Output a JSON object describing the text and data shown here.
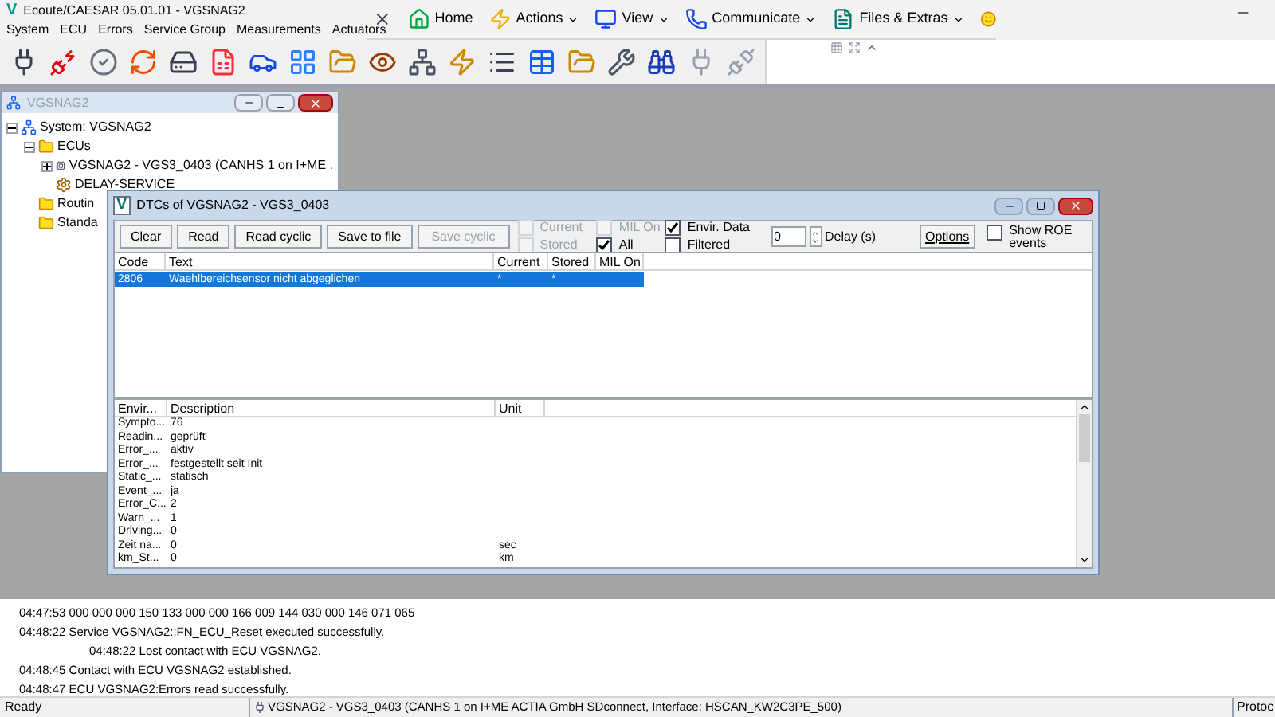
{
  "window": {
    "title": "Ecoute/CAESAR 05.01.01 - VGSNAG2",
    "logo": "V"
  },
  "menu": [
    "System",
    "ECU",
    "Errors",
    "Service Group",
    "Measurements",
    "Actuators"
  ],
  "ribbon": [
    {
      "label": "Home",
      "kind": "home"
    },
    {
      "label": "Actions",
      "kind": "actions"
    },
    {
      "label": "View",
      "kind": "view"
    },
    {
      "label": "Communicate",
      "kind": "communicate"
    },
    {
      "label": "Files & Extras",
      "kind": "files"
    }
  ],
  "tree_window": {
    "title": "VGSNAG2",
    "tree": [
      {
        "label": "System: VGSNAG2",
        "expanded": true,
        "children": [
          {
            "label": "ECUs",
            "expanded": true,
            "children": [
              {
                "label": "VGSNAG2 - VGS3_0403 (CANHS 1 on I+ME .",
                "expanded": false,
                "kind": "ecu"
              },
              {
                "label": "DELAY-SERVICE",
                "kind": "service"
              }
            ]
          },
          {
            "label": "Routin"
          },
          {
            "label": "Standa"
          }
        ]
      }
    ]
  },
  "dtc_window": {
    "title": "DTCs of VGSNAG2 - VGS3_0403",
    "logo": "V",
    "buttons": [
      {
        "label": "Clear",
        "disabled": false
      },
      {
        "label": "Read",
        "disabled": false
      },
      {
        "label": "Read cyclic",
        "disabled": false
      },
      {
        "label": "Save to file",
        "disabled": false
      },
      {
        "label": "Save cyclic",
        "disabled": true
      }
    ],
    "checks": [
      {
        "label": "Current",
        "checked": false,
        "disabled": true
      },
      {
        "label": "Stored",
        "checked": false,
        "disabled": true
      },
      {
        "label": "MIL On",
        "checked": false,
        "disabled": true
      },
      {
        "label": "All",
        "checked": true,
        "disabled": false
      },
      {
        "label": "Envir. Data",
        "checked": true,
        "disabled": false
      },
      {
        "label": "Filtered",
        "checked": false,
        "disabled": false
      }
    ],
    "delay": {
      "value": "0",
      "label": "Delay (s)"
    },
    "options": "Options",
    "roe": {
      "label": "Show ROE events",
      "checked": false
    },
    "dtc_table": {
      "columns": [
        "Code",
        "Text",
        "Current",
        "Stored",
        "MIL On"
      ],
      "rows": [
        {
          "selected": true,
          "cells": [
            "2806",
            "Waehlbereichsensor nicht abgeglichen",
            "*",
            "*",
            ""
          ]
        }
      ]
    },
    "env_table": {
      "columns": [
        "Envir...",
        "Description",
        "Unit"
      ],
      "rows": [
        {
          "cells": [
            "Sympto...",
            "76",
            ""
          ]
        },
        {
          "cells": [
            "Readin...",
            "geprüft",
            ""
          ]
        },
        {
          "cells": [
            "Error_...",
            "aktiv",
            ""
          ]
        },
        {
          "cells": [
            "Error_...",
            "festgestellt seit Init",
            ""
          ]
        },
        {
          "cells": [
            "Static_...",
            "statisch",
            ""
          ]
        },
        {
          "cells": [
            "Event_...",
            "ja",
            ""
          ]
        },
        {
          "cells": [
            "Error_C...",
            "2",
            ""
          ]
        },
        {
          "cells": [
            "Warn_...",
            "1",
            ""
          ]
        },
        {
          "cells": [
            "Driving...",
            "0",
            ""
          ]
        },
        {
          "cells": [
            "Zeit na...",
            "0",
            "sec"
          ]
        },
        {
          "cells": [
            "km_St...",
            "0",
            "km"
          ]
        }
      ]
    }
  },
  "log": [
    {
      "text": "04:47:53  000 000 000 150 133 000 000 166 009 144 030 000 146 071 065",
      "indent": false
    },
    {
      "text": "04:48:22 Service VGSNAG2::FN_ECU_Reset executed successfully.",
      "indent": false
    },
    {
      "text": "04:48:22 Lost contact with ECU VGSNAG2.",
      "indent": true
    },
    {
      "text": "04:48:45 Contact with ECU VGSNAG2 established.",
      "indent": false
    },
    {
      "text": "04:48:47 ECU VGSNAG2:Errors read successfully.",
      "indent": false
    }
  ],
  "status_bar": {
    "state": "Ready",
    "connection": "VGSNAG2 - VGS3_0403 (CANHS 1 on I+ME ACTIA GmbH SDconnect, Interface: HSCAN_KW2C3PE_500)",
    "column_3": "Protoc"
  }
}
